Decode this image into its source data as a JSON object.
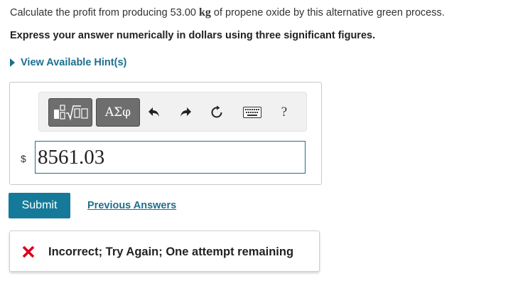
{
  "question": {
    "prefix": "Calculate the profit from producing 53.00 ",
    "unit": "kg",
    "suffix": " of propene oxide by this alternative green process.",
    "instruction": "Express your answer numerically in dollars using three significant figures."
  },
  "hint": {
    "label": "View Available Hint(s)",
    "icon": "triangle-right-icon"
  },
  "toolbar": {
    "templates_icon": "templates-icon",
    "symbols_label": "ΑΣφ",
    "undo_icon": "undo-icon",
    "redo_icon": "redo-icon",
    "reset_icon": "reset-icon",
    "keyboard_icon": "keyboard-icon",
    "help_label": "?"
  },
  "answer": {
    "currency": "$",
    "value": "8561.03"
  },
  "actions": {
    "submit_label": "Submit",
    "previous_answers_label": "Previous Answers"
  },
  "feedback": {
    "message": "Incorrect; Try Again; One attempt remaining",
    "status_color": "#d9001b",
    "icon": "x-mark-icon"
  },
  "colors": {
    "accent": "#157a99",
    "link": "#1d6f8f"
  }
}
